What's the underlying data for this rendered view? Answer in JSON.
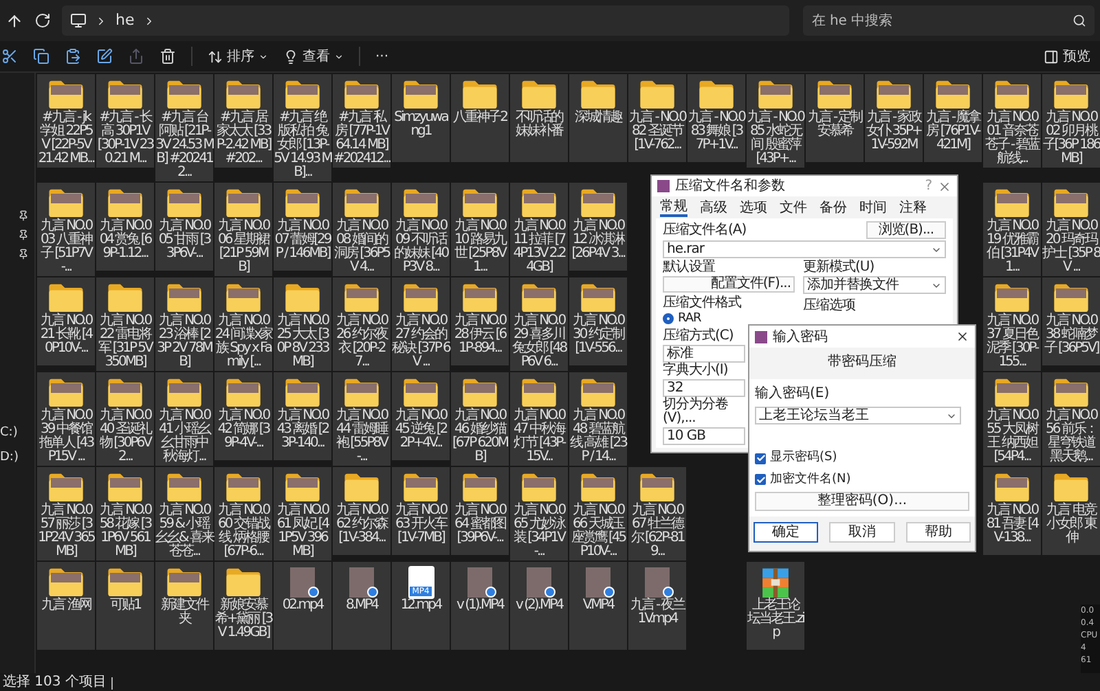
{
  "address": {
    "crumbs": [
      "he"
    ]
  },
  "search": {
    "placeholder": "在 he 中搜索"
  },
  "toolbar": {
    "sort": "排序",
    "view": "查看",
    "more": "···",
    "preview": "预览"
  },
  "sidebar": {
    "drives": [
      "C:)",
      "D:)"
    ]
  },
  "grid": [
    {
      "items": [
        {
          "kind": "folder",
          "preview": true,
          "selected": true,
          "name": "#九言 - jk学姐 22P5V [22P-5V 21.42 MB..."
        },
        {
          "kind": "folder",
          "preview": true,
          "selected": true,
          "name": "#九言 - 长高 30P1V [30P-1V 230.21 M..."
        },
        {
          "kind": "folder",
          "preview": true,
          "selected": true,
          "name": "#九言 台阿贴 [21P-3V 24.53 MB] #202412..."
        },
        {
          "kind": "folder",
          "preview": true,
          "selected": true,
          "name": "#九言 居家太太 [33P-2.42 MB] #202..."
        },
        {
          "kind": "folder",
          "preview": true,
          "selected": true,
          "name": "#九言 绝版私拍 兔女郎 [13P-5V 14.93 MB]..."
        },
        {
          "kind": "folder",
          "preview": true,
          "selected": true,
          "name": "#九言 私房 [77P-1V 64.14 MB] #202412..."
        },
        {
          "kind": "folder",
          "preview": true,
          "selected": true,
          "name": "Simzyuwang1"
        },
        {
          "kind": "folder",
          "preview": false,
          "selected": true,
          "name": "八重神子2"
        },
        {
          "kind": "folder",
          "preview": false,
          "selected": true,
          "name": "不听话的妹妹补番"
        },
        {
          "kind": "folder",
          "preview": false,
          "selected": true,
          "name": "深城情趣"
        },
        {
          "kind": "folder",
          "preview": false,
          "selected": true,
          "name": "九言 - NO.082 圣诞节 [1V-762..."
        },
        {
          "kind": "folder",
          "preview": false,
          "selected": true,
          "name": "九言 - NO.083 舞娘 [37P+1V..."
        },
        {
          "kind": "folder",
          "preview": true,
          "selected": true,
          "name": "九言 - NO.085 水蛇无间 殷蜜萍 [43P+..."
        },
        {
          "kind": "folder",
          "preview": true,
          "selected": true,
          "name": "九言 - 定制安慕希"
        },
        {
          "kind": "folder",
          "preview": true,
          "selected": true,
          "name": "九言 - 家政女仆 35P+1V-592M"
        },
        {
          "kind": "folder",
          "preview": true,
          "selected": true,
          "name": "九言 - 魔拿房 [76P1V-421M]"
        },
        {
          "kind": "folder",
          "preview": true,
          "selected": true,
          "name": "九言 NO.001 音奈苍苍子 - 碧蓝航线..."
        },
        {
          "kind": "folder",
          "preview": true,
          "selected": true,
          "name": "九言 NO.002 卯月桃子[36P 186MB]"
        }
      ]
    },
    {
      "items": [
        {
          "kind": "folder",
          "preview": true,
          "selected": true,
          "name": "九言 NO.003 八重神子 [51P7V-..."
        },
        {
          "kind": "folder",
          "preview": true,
          "selected": true,
          "name": "九言 NO.004 赏兔 [69P-1.12..."
        },
        {
          "kind": "folder",
          "preview": true,
          "selected": true,
          "name": "九言 NO.005 甘雨 [33P6V-..."
        },
        {
          "kind": "folder",
          "preview": true,
          "selected": true,
          "name": "九言 NO.006 星期裙[21P 59MB]"
        },
        {
          "kind": "folder",
          "preview": true,
          "selected": true,
          "name": "九言 NO.007 蕾姆[29P / 146MB]"
        },
        {
          "kind": "folder",
          "preview": true,
          "selected": true,
          "name": "九言 NO.008 婚间的洞房 [36P5V 4..."
        },
        {
          "kind": "folder",
          "preview": true,
          "selected": true,
          "name": "九言 NO.009 不听话的妹妹 [40P3V 8..."
        },
        {
          "kind": "folder",
          "preview": true,
          "selected": true,
          "name": "九言 NO.010 路易九世 [25P8V 1..."
        },
        {
          "kind": "folder",
          "preview": true,
          "selected": true,
          "name": "九言 NO.011 拉菲 [74P13V 2.24GB]"
        },
        {
          "kind": "folder",
          "preview": true,
          "selected": true,
          "name": "九言 NO.012 冰淇淋 [26P4V 3..."
        },
        {
          "kind": "hidden"
        },
        {
          "kind": "hidden"
        },
        {
          "kind": "hidden"
        },
        {
          "kind": "hidden"
        },
        {
          "kind": "hidden"
        },
        {
          "kind": "hidden"
        },
        {
          "kind": "folder",
          "preview": true,
          "selected": true,
          "name": "九言 NO.019 优雅霸伯 [31P4V 1..."
        },
        {
          "kind": "folder",
          "preview": true,
          "selected": true,
          "name": "九言 NO.020 玛奇玛护士 [35P 8V ..."
        }
      ]
    },
    {
      "items": [
        {
          "kind": "folder",
          "preview": false,
          "selected": true,
          "name": "九言 NO.021 长靴 [40P10V-..."
        },
        {
          "kind": "folder",
          "preview": false,
          "selected": true,
          "name": "九言 NO.022 雷电将军 [31P 5V 350MB]"
        },
        {
          "kind": "folder",
          "preview": true,
          "selected": true,
          "name": "九言 NO.023 浴棒 [23P 2V 78MB]"
        },
        {
          "kind": "folder",
          "preview": true,
          "selected": true,
          "name": "九言 NO.024 间谍x家族 Spy x Family [..."
        },
        {
          "kind": "folder",
          "preview": false,
          "selected": true,
          "name": "九言 NO.025 大太 [30P 8V 233MB]"
        },
        {
          "kind": "folder",
          "preview": true,
          "selected": true,
          "name": "九言 NO.026 约尔夜衣 [20P-27..."
        },
        {
          "kind": "folder",
          "preview": true,
          "selected": true,
          "name": "九言 NO.027 约会的秘诀 [37P 6V ..."
        },
        {
          "kind": "folder",
          "preview": true,
          "selected": true,
          "name": "九言 NO.028 伊云 [61P-894..."
        },
        {
          "kind": "folder",
          "preview": true,
          "selected": true,
          "name": "九言 NO.029 喜多川兔女郎 [48P6V 6..."
        },
        {
          "kind": "folder",
          "preview": true,
          "selected": true,
          "name": "九言 NO.030 约定制 [1V-556..."
        },
        {
          "kind": "hidden"
        },
        {
          "kind": "hidden"
        },
        {
          "kind": "hidden"
        },
        {
          "kind": "hidden"
        },
        {
          "kind": "hidden"
        },
        {
          "kind": "hidden"
        },
        {
          "kind": "folder",
          "preview": true,
          "selected": true,
          "name": "九言 NO.037 夏日色泥季 [30P-155..."
        },
        {
          "kind": "folder",
          "preview": true,
          "selected": true,
          "name": "九言 NO.038 蛇喃梦子 [36P5V]"
        }
      ]
    },
    {
      "items": [
        {
          "kind": "folder",
          "preview": true,
          "selected": true,
          "name": "九言 NO.039 中餐馆拖单人 [43P15V ..."
        },
        {
          "kind": "folder",
          "preview": true,
          "selected": true,
          "name": "九言 NO.040 圣诞礼物 [30P6V 2..."
        },
        {
          "kind": "folder",
          "preview": true,
          "selected": true,
          "name": "九言 NO.041 小瑶幺幺甘雨中秋海灯..."
        },
        {
          "kind": "folder",
          "preview": true,
          "selected": true,
          "name": "九言 NO.042 简娜 [39P-4V-..."
        },
        {
          "kind": "folder",
          "preview": true,
          "selected": true,
          "name": "九言 NO.043 离婚 [23P-140..."
        },
        {
          "kind": "folder",
          "preview": true,
          "selected": true,
          "name": "九言 NO.044 雷姆睡袍 [55P8V-..."
        },
        {
          "kind": "folder",
          "preview": true,
          "selected": true,
          "name": "九言 NO.045 逆兔 [22P+4V..."
        },
        {
          "kind": "folder",
          "preview": true,
          "selected": true,
          "name": "九言 NO.046 婚纱猫 [67P 620MB]"
        },
        {
          "kind": "folder",
          "preview": true,
          "selected": true,
          "name": "九言 NO.047 中秋海灯节 [43P-15V..."
        },
        {
          "kind": "folder",
          "preview": true,
          "selected": true,
          "name": "九言 NO.048 碧蓝航线 高雄 [23P / 14..."
        },
        {
          "kind": "hidden"
        },
        {
          "kind": "hidden"
        },
        {
          "kind": "hidden"
        },
        {
          "kind": "hidden"
        },
        {
          "kind": "hidden"
        },
        {
          "kind": "hidden"
        },
        {
          "kind": "folder",
          "preview": true,
          "selected": true,
          "name": "九言 NO.055 大凤树王 纳西妲 [54P4..."
        },
        {
          "kind": "folder",
          "preview": true,
          "selected": true,
          "name": "九言 NO.056 前乐：星穹铁道黑天鹅..."
        }
      ]
    },
    {
      "items": [
        {
          "kind": "folder",
          "preview": true,
          "selected": true,
          "name": "九言 NO.057 丽莎 [31P24V 365MB]"
        },
        {
          "kind": "folder",
          "preview": true,
          "selected": true,
          "name": "九言 NO.058 花嫁 [31P6V 561MB]"
        },
        {
          "kind": "folder",
          "preview": true,
          "selected": true,
          "name": "九言 NO.059 & 小瑶幺幺& 喜来苍苍..."
        },
        {
          "kind": "folder",
          "preview": true,
          "selected": true,
          "name": "九言 NO.060 交错战线 炳格腰 [67P-6..."
        },
        {
          "kind": "folder",
          "preview": true,
          "selected": true,
          "name": "九言 NO.061 凤妃 [41P5V 396MB]"
        },
        {
          "kind": "folder",
          "preview": false,
          "selected": true,
          "name": "九言 NO.062 约尔森 [1V-384..."
        },
        {
          "kind": "folder",
          "preview": true,
          "selected": true,
          "name": "九言 NO.063 开火车 [1V-7MB]"
        },
        {
          "kind": "folder",
          "preview": true,
          "selected": true,
          "name": "九言 NO.064 蜜都图 [39P6V-..."
        },
        {
          "kind": "folder",
          "preview": true,
          "selected": true,
          "name": "九言 NO.065 尤妙泳装 [34P1V-..."
        },
        {
          "kind": "folder",
          "preview": true,
          "selected": true,
          "name": "九言 NO.066 天城玉座赏鹰 [45P10V-..."
        },
        {
          "kind": "folder",
          "preview": true,
          "selected": true,
          "name": "九言 NO.067 牡兰德尔 [62P-819..."
        },
        {
          "kind": "hidden"
        },
        {
          "kind": "hidden"
        },
        {
          "kind": "hidden"
        },
        {
          "kind": "hidden"
        },
        {
          "kind": "hidden"
        },
        {
          "kind": "folder",
          "preview": true,
          "selected": true,
          "name": "九言 NO.081 吾妻 [4V-138..."
        },
        {
          "kind": "folder",
          "preview": false,
          "selected": true,
          "name": "九言 电竞小女郎 東伸"
        }
      ]
    },
    {
      "items": [
        {
          "kind": "folder",
          "preview": true,
          "selected": true,
          "name": "九言 渔网"
        },
        {
          "kind": "folder",
          "preview": true,
          "selected": true,
          "name": "可贴1"
        },
        {
          "kind": "folder",
          "preview": true,
          "selected": true,
          "name": "新建文件夹"
        },
        {
          "kind": "folder",
          "preview": false,
          "selected": true,
          "name": "新娘安慕希+黛丽 [3V 1.49GB]"
        },
        {
          "kind": "video",
          "selected": true,
          "name": "02.mp4"
        },
        {
          "kind": "video",
          "selected": true,
          "name": "8.MP4"
        },
        {
          "kind": "file",
          "selected": true,
          "name": "12.mp4",
          "icon_label": "MP4"
        },
        {
          "kind": "video",
          "selected": true,
          "name": "v (1).MP4"
        },
        {
          "kind": "video",
          "selected": true,
          "name": "v (2).MP4"
        },
        {
          "kind": "video",
          "selected": true,
          "name": "V.MP4"
        },
        {
          "kind": "video",
          "selected": true,
          "name": "九言 - 夜兰1V.mp4"
        },
        {
          "kind": "hidden"
        },
        {
          "kind": "archive",
          "selected": true,
          "name": "上老王论坛当老王.zip"
        }
      ]
    }
  ],
  "status_bar": {
    "text": "选择 103 个项目"
  },
  "monitor": {
    "readings": [
      "0.0",
      "0.4",
      "CPU",
      "4",
      "61"
    ]
  },
  "archive_dialog": {
    "title": "压缩文件名和参数",
    "help": "?",
    "tabs": [
      {
        "label": "常规",
        "selected": true
      },
      {
        "label": "高级",
        "selected": false
      },
      {
        "label": "选项",
        "selected": false
      },
      {
        "label": "文件",
        "selected": false
      },
      {
        "label": "备份",
        "selected": false
      },
      {
        "label": "时间",
        "selected": false
      },
      {
        "label": "注释",
        "selected": false
      }
    ],
    "name_label": "压缩文件名(A)",
    "name_value": "he.rar",
    "browse": "浏览(B)...",
    "defaults_label": "默认设置",
    "profiles": "配置文件(F)...",
    "update_label": "更新模式(U)",
    "update_value": "添加并替换文件",
    "format_label": "压缩文件格式",
    "formats": [
      {
        "label": "RAR",
        "selected": true
      }
    ],
    "options_label": "压缩选项",
    "method_label": "压缩方式(C)",
    "method_value": "标准",
    "dict_label": "字典大小(I)",
    "dict_value": "32",
    "split_label": "切分为分卷(V),...",
    "split_value": "10 GB"
  },
  "password_dialog": {
    "title": "输入密码",
    "subtitle": "带密码压缩",
    "field_label": "输入密码(E)",
    "value": "上老王论坛当老王",
    "options": [
      {
        "label": "显示密码(S)",
        "checked": true
      },
      {
        "label": "加密文件名(N)",
        "checked": true
      }
    ],
    "organize": "整理密码(O)...",
    "buttons": [
      {
        "label": "确定",
        "default": true
      },
      {
        "label": "取消",
        "default": false
      },
      {
        "label": "帮助",
        "default": false
      }
    ]
  }
}
